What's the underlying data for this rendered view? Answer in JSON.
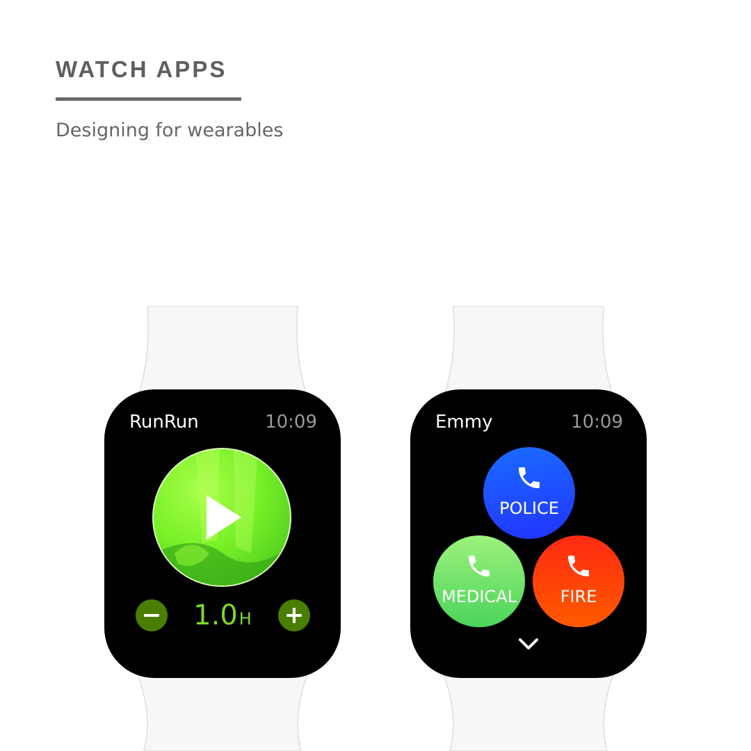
{
  "header": {
    "title": "WATCH APPS",
    "subtitle": "Designing for wearables"
  },
  "watches": [
    {
      "app_title": "RunRun",
      "time": "10:09",
      "duration_value": "1.0",
      "duration_unit": "H",
      "accent_color": "#7cd62c"
    },
    {
      "app_title": "Emmy",
      "time": "10:09",
      "buttons": [
        {
          "label": "POLICE",
          "color": "#2233ff"
        },
        {
          "label": "MEDICAL",
          "color": "#4bd45c"
        },
        {
          "label": "FIRE",
          "color": "#ff3a0a"
        }
      ]
    }
  ],
  "icons": {
    "play": "play-icon",
    "minus": "minus-icon",
    "plus": "plus-icon",
    "phone": "phone-icon",
    "chevron": "chevron-down-icon"
  }
}
